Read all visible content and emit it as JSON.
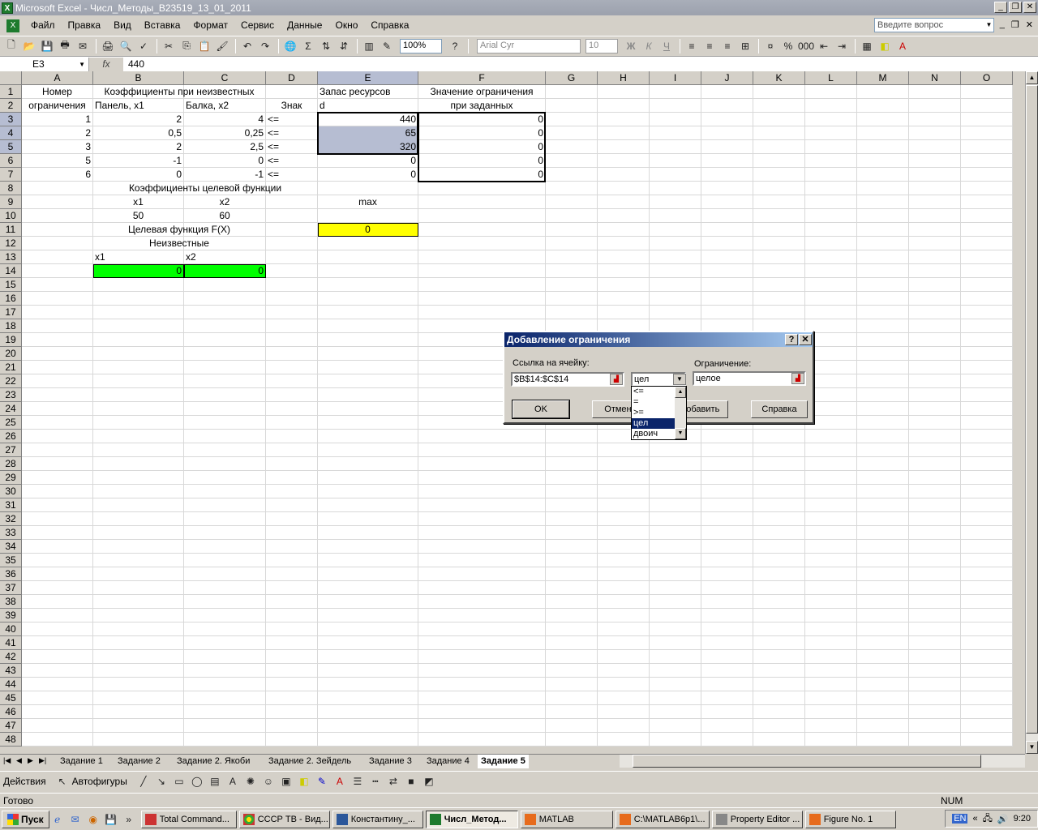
{
  "window": {
    "title": "Microsoft Excel - Числ_Методы_B23519_13_01_2011",
    "app_icon": "X"
  },
  "menu": [
    {
      "label": "Файл"
    },
    {
      "label": "Правка"
    },
    {
      "label": "Вид"
    },
    {
      "label": "Вставка"
    },
    {
      "label": "Формат"
    },
    {
      "label": "Сервис"
    },
    {
      "label": "Данные"
    },
    {
      "label": "Окно"
    },
    {
      "label": "Справка"
    }
  ],
  "ask_placeholder": "Введите вопрос",
  "toolbar": {
    "zoom": "100%",
    "font": "Arial Cyr",
    "size": "10",
    "bold": "Ж",
    "italic": "К",
    "underline": "Ч"
  },
  "formula": {
    "namebox": "E3",
    "fx": "fx",
    "value": "440"
  },
  "columns": [
    "A",
    "B",
    "C",
    "D",
    "E",
    "F",
    "G",
    "H",
    "I",
    "J",
    "K",
    "L",
    "M",
    "N",
    "O"
  ],
  "rows": [
    "1",
    "2",
    "3",
    "4",
    "5",
    "6",
    "7",
    "8",
    "9",
    "10",
    "11",
    "12",
    "13",
    "14",
    "15",
    "16",
    "17",
    "18",
    "19",
    "20",
    "21",
    "22",
    "23",
    "24",
    "25",
    "26",
    "27",
    "28",
    "29",
    "30",
    "31",
    "32",
    "33",
    "34",
    "35",
    "36",
    "37",
    "38",
    "39",
    "40",
    "41",
    "42",
    "43",
    "44",
    "45",
    "46",
    "47",
    "48"
  ],
  "cells": {
    "A1": "Номер",
    "A2": "ограничения",
    "B1": "Коэффициенты при неизвестных",
    "B2": "Панель, x1",
    "C2": "Балка, x2",
    "D2": "Знак",
    "E1": "Запас ресурсов",
    "E2": "d",
    "F1": "Значение ограничения",
    "F2": "при заданных",
    "A3": "1",
    "A4": "2",
    "A5": "3",
    "A6": "5",
    "A7": "6",
    "B3": "2",
    "B4": "0,5",
    "B5": "2",
    "B6": "-1",
    "B7": "0",
    "C3": "4",
    "C4": "0,25",
    "C5": "2,5",
    "C6": "0",
    "C7": "-1",
    "D3": "<=",
    "D4": "<=",
    "D5": "<=",
    "D6": "<=",
    "D7": "<=",
    "E3": "440",
    "E4": "65",
    "E5": "320",
    "E6": "0",
    "E7": "0",
    "F3": "0",
    "F4": "0",
    "F5": "0",
    "F6": "0",
    "F7": "0",
    "B8": "Коэффициенты целевой функции",
    "B9": "x1",
    "C9": "x2",
    "E9": "max",
    "B10": "50",
    "C10": "60",
    "B11": "Целевая функция F(X)",
    "E11": "0",
    "B12": "Неизвестные",
    "B13": "x1",
    "C13": "x2",
    "B14": "0",
    "C14": "0"
  },
  "sheets": [
    {
      "label": "Задание 1"
    },
    {
      "label": "Задание 2"
    },
    {
      "label": "Задание 2. Якоби"
    },
    {
      "label": "Задание 2. Зейдель"
    },
    {
      "label": "Задание 3"
    },
    {
      "label": "Задание 4"
    },
    {
      "label": "Задание 5",
      "active": true
    }
  ],
  "drawbar": {
    "actions": "Действия",
    "autoshapes": "Автофигуры"
  },
  "status": {
    "ready": "Готово",
    "num": "NUM"
  },
  "dialog": {
    "title": "Добавление ограничения",
    "help_btn": "?",
    "close_btn": "✕",
    "ref_label": "Ссылка на ячейку:",
    "ref_value": "$B$14:$C$14",
    "op_value": "цел",
    "constraint_label": "Ограничение:",
    "constraint_value": "целое",
    "ok": "OK",
    "cancel": "Отмена",
    "add": "Добавить",
    "help": "Справка",
    "options": [
      "<=",
      "=",
      ">=",
      "цел",
      "двоич"
    ],
    "selected_option": "цел"
  },
  "taskbar": {
    "start": "Пуск",
    "tasks": [
      {
        "label": "Total Command..."
      },
      {
        "label": "СССР ТВ - Вид..."
      },
      {
        "label": "Константину_..."
      },
      {
        "label": "Числ_Метод...",
        "active": true
      },
      {
        "label": "MATLAB"
      },
      {
        "label": "C:\\MATLAB6p1\\..."
      },
      {
        "label": "Property Editor ..."
      },
      {
        "label": "Figure No. 1"
      }
    ],
    "lang": "EN",
    "clock": "9:20"
  },
  "colors": {
    "selection": "#b6bdd2",
    "yellow": "#ffff00",
    "green": "#00ff00",
    "title_active": "#0a246a"
  }
}
